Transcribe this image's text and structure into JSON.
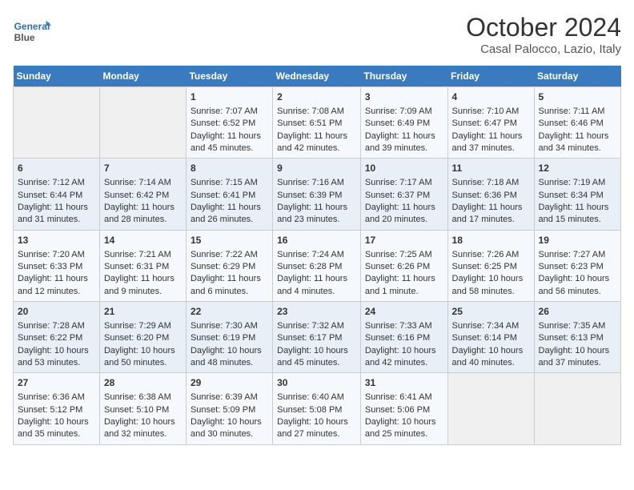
{
  "header": {
    "logo_line1": "General",
    "logo_line2": "Blue",
    "month": "October 2024",
    "location": "Casal Palocco, Lazio, Italy"
  },
  "days_of_week": [
    "Sunday",
    "Monday",
    "Tuesday",
    "Wednesday",
    "Thursday",
    "Friday",
    "Saturday"
  ],
  "weeks": [
    [
      {
        "day": "",
        "empty": true
      },
      {
        "day": "",
        "empty": true
      },
      {
        "day": "1",
        "sunrise": "Sunrise: 7:07 AM",
        "sunset": "Sunset: 6:52 PM",
        "daylight": "Daylight: 11 hours and 45 minutes."
      },
      {
        "day": "2",
        "sunrise": "Sunrise: 7:08 AM",
        "sunset": "Sunset: 6:51 PM",
        "daylight": "Daylight: 11 hours and 42 minutes."
      },
      {
        "day": "3",
        "sunrise": "Sunrise: 7:09 AM",
        "sunset": "Sunset: 6:49 PM",
        "daylight": "Daylight: 11 hours and 39 minutes."
      },
      {
        "day": "4",
        "sunrise": "Sunrise: 7:10 AM",
        "sunset": "Sunset: 6:47 PM",
        "daylight": "Daylight: 11 hours and 37 minutes."
      },
      {
        "day": "5",
        "sunrise": "Sunrise: 7:11 AM",
        "sunset": "Sunset: 6:46 PM",
        "daylight": "Daylight: 11 hours and 34 minutes."
      }
    ],
    [
      {
        "day": "6",
        "sunrise": "Sunrise: 7:12 AM",
        "sunset": "Sunset: 6:44 PM",
        "daylight": "Daylight: 11 hours and 31 minutes."
      },
      {
        "day": "7",
        "sunrise": "Sunrise: 7:14 AM",
        "sunset": "Sunset: 6:42 PM",
        "daylight": "Daylight: 11 hours and 28 minutes."
      },
      {
        "day": "8",
        "sunrise": "Sunrise: 7:15 AM",
        "sunset": "Sunset: 6:41 PM",
        "daylight": "Daylight: 11 hours and 26 minutes."
      },
      {
        "day": "9",
        "sunrise": "Sunrise: 7:16 AM",
        "sunset": "Sunset: 6:39 PM",
        "daylight": "Daylight: 11 hours and 23 minutes."
      },
      {
        "day": "10",
        "sunrise": "Sunrise: 7:17 AM",
        "sunset": "Sunset: 6:37 PM",
        "daylight": "Daylight: 11 hours and 20 minutes."
      },
      {
        "day": "11",
        "sunrise": "Sunrise: 7:18 AM",
        "sunset": "Sunset: 6:36 PM",
        "daylight": "Daylight: 11 hours and 17 minutes."
      },
      {
        "day": "12",
        "sunrise": "Sunrise: 7:19 AM",
        "sunset": "Sunset: 6:34 PM",
        "daylight": "Daylight: 11 hours and 15 minutes."
      }
    ],
    [
      {
        "day": "13",
        "sunrise": "Sunrise: 7:20 AM",
        "sunset": "Sunset: 6:33 PM",
        "daylight": "Daylight: 11 hours and 12 minutes."
      },
      {
        "day": "14",
        "sunrise": "Sunrise: 7:21 AM",
        "sunset": "Sunset: 6:31 PM",
        "daylight": "Daylight: 11 hours and 9 minutes."
      },
      {
        "day": "15",
        "sunrise": "Sunrise: 7:22 AM",
        "sunset": "Sunset: 6:29 PM",
        "daylight": "Daylight: 11 hours and 6 minutes."
      },
      {
        "day": "16",
        "sunrise": "Sunrise: 7:24 AM",
        "sunset": "Sunset: 6:28 PM",
        "daylight": "Daylight: 11 hours and 4 minutes."
      },
      {
        "day": "17",
        "sunrise": "Sunrise: 7:25 AM",
        "sunset": "Sunset: 6:26 PM",
        "daylight": "Daylight: 11 hours and 1 minute."
      },
      {
        "day": "18",
        "sunrise": "Sunrise: 7:26 AM",
        "sunset": "Sunset: 6:25 PM",
        "daylight": "Daylight: 10 hours and 58 minutes."
      },
      {
        "day": "19",
        "sunrise": "Sunrise: 7:27 AM",
        "sunset": "Sunset: 6:23 PM",
        "daylight": "Daylight: 10 hours and 56 minutes."
      }
    ],
    [
      {
        "day": "20",
        "sunrise": "Sunrise: 7:28 AM",
        "sunset": "Sunset: 6:22 PM",
        "daylight": "Daylight: 10 hours and 53 minutes."
      },
      {
        "day": "21",
        "sunrise": "Sunrise: 7:29 AM",
        "sunset": "Sunset: 6:20 PM",
        "daylight": "Daylight: 10 hours and 50 minutes."
      },
      {
        "day": "22",
        "sunrise": "Sunrise: 7:30 AM",
        "sunset": "Sunset: 6:19 PM",
        "daylight": "Daylight: 10 hours and 48 minutes."
      },
      {
        "day": "23",
        "sunrise": "Sunrise: 7:32 AM",
        "sunset": "Sunset: 6:17 PM",
        "daylight": "Daylight: 10 hours and 45 minutes."
      },
      {
        "day": "24",
        "sunrise": "Sunrise: 7:33 AM",
        "sunset": "Sunset: 6:16 PM",
        "daylight": "Daylight: 10 hours and 42 minutes."
      },
      {
        "day": "25",
        "sunrise": "Sunrise: 7:34 AM",
        "sunset": "Sunset: 6:14 PM",
        "daylight": "Daylight: 10 hours and 40 minutes."
      },
      {
        "day": "26",
        "sunrise": "Sunrise: 7:35 AM",
        "sunset": "Sunset: 6:13 PM",
        "daylight": "Daylight: 10 hours and 37 minutes."
      }
    ],
    [
      {
        "day": "27",
        "sunrise": "Sunrise: 6:36 AM",
        "sunset": "Sunset: 5:12 PM",
        "daylight": "Daylight: 10 hours and 35 minutes."
      },
      {
        "day": "28",
        "sunrise": "Sunrise: 6:38 AM",
        "sunset": "Sunset: 5:10 PM",
        "daylight": "Daylight: 10 hours and 32 minutes."
      },
      {
        "day": "29",
        "sunrise": "Sunrise: 6:39 AM",
        "sunset": "Sunset: 5:09 PM",
        "daylight": "Daylight: 10 hours and 30 minutes."
      },
      {
        "day": "30",
        "sunrise": "Sunrise: 6:40 AM",
        "sunset": "Sunset: 5:08 PM",
        "daylight": "Daylight: 10 hours and 27 minutes."
      },
      {
        "day": "31",
        "sunrise": "Sunrise: 6:41 AM",
        "sunset": "Sunset: 5:06 PM",
        "daylight": "Daylight: 10 hours and 25 minutes."
      },
      {
        "day": "",
        "empty": true
      },
      {
        "day": "",
        "empty": true
      }
    ]
  ]
}
